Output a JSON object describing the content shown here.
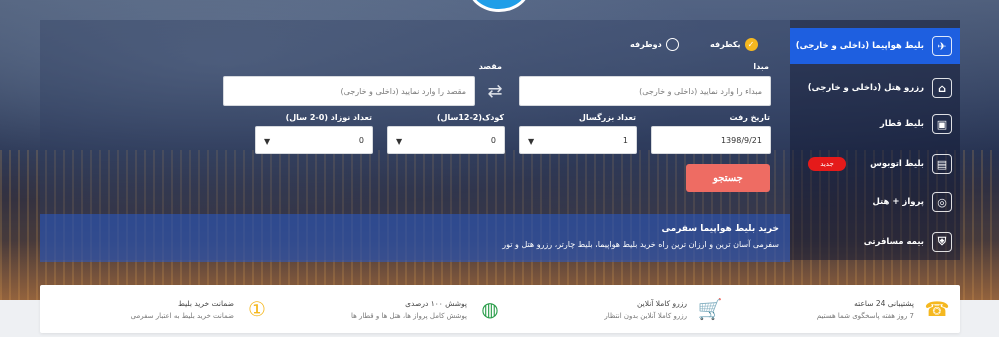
{
  "sidebar": {
    "items": [
      {
        "label": "بلیط هواپیما (داخلی و خارجی)",
        "icon": "airplane-icon",
        "glyph": "✈"
      },
      {
        "label": "رزرو هتل (داخلی و خارجی)",
        "icon": "hotel-icon",
        "glyph": "⌂"
      },
      {
        "label": "بلیط قطار",
        "icon": "train-icon",
        "glyph": "▣"
      },
      {
        "label": "بلیط اتوبوس",
        "icon": "bus-icon",
        "glyph": "▤"
      },
      {
        "label": "پرواز + هتل",
        "icon": "globe-icon",
        "glyph": "◎"
      },
      {
        "label": "بیمه مسافرتی",
        "icon": "shield-icon",
        "glyph": "⛨"
      }
    ],
    "new_badge": "جدید"
  },
  "trip_type": {
    "one_way": "یکطرفه",
    "round_trip": "دوطرفه",
    "selected": "one_way"
  },
  "form": {
    "origin_label": "مبدا",
    "origin_placeholder": "مبداء را وارد نمایید (داخلی و خارجی)",
    "destination_label": "مقصد",
    "destination_placeholder": "مقصد را وارد نمایید (داخلی و خارجی)",
    "date_label": "تاریخ رفت",
    "date_value": "1398/9/21",
    "adults_label": "تعداد بزرگسال",
    "adults_value": "1",
    "children_label": "کودک(2-12سال)",
    "children_value": "0",
    "infants_label": "تعداد نوزاد (0-2 سال)",
    "infants_value": "0",
    "search_button": "جستجو"
  },
  "info": {
    "title": "خرید بلیط هواپیما سفرمی",
    "description": "سفرمی آسان ترین و ارزان ترین راه خرید بلیط هواپیما، بلیط چارتر، رزرو هتل و تور"
  },
  "features": [
    {
      "title": "پشتیبانی 24 ساعته",
      "subtitle": "7 روز هفته پاسخگوی شما هستیم",
      "icon": "support-agent-icon",
      "glyph": "☎"
    },
    {
      "title": "رزرو کاملا آنلاین",
      "subtitle": "رزرو کاملا آنلاین بدون انتظار",
      "icon": "shopping-cart-icon",
      "glyph": "🛒"
    },
    {
      "title": "پوشش ۱۰۰ درصدی",
      "subtitle": "پوشش کامل پرواز ها، هتل ها و قطار ها",
      "icon": "globe-coverage-icon",
      "glyph": "◍"
    },
    {
      "title": "ضمانت خرید بلیط",
      "subtitle": "ضمانت خرید بلیط به اعتبار سفرمی",
      "icon": "award-badge-icon",
      "glyph": "①"
    }
  ],
  "colors": {
    "active_tab": "#1e5fe0",
    "search_button": "#ee6c63",
    "badge": "#e51a1a",
    "radio_selected": "#f5b820"
  }
}
